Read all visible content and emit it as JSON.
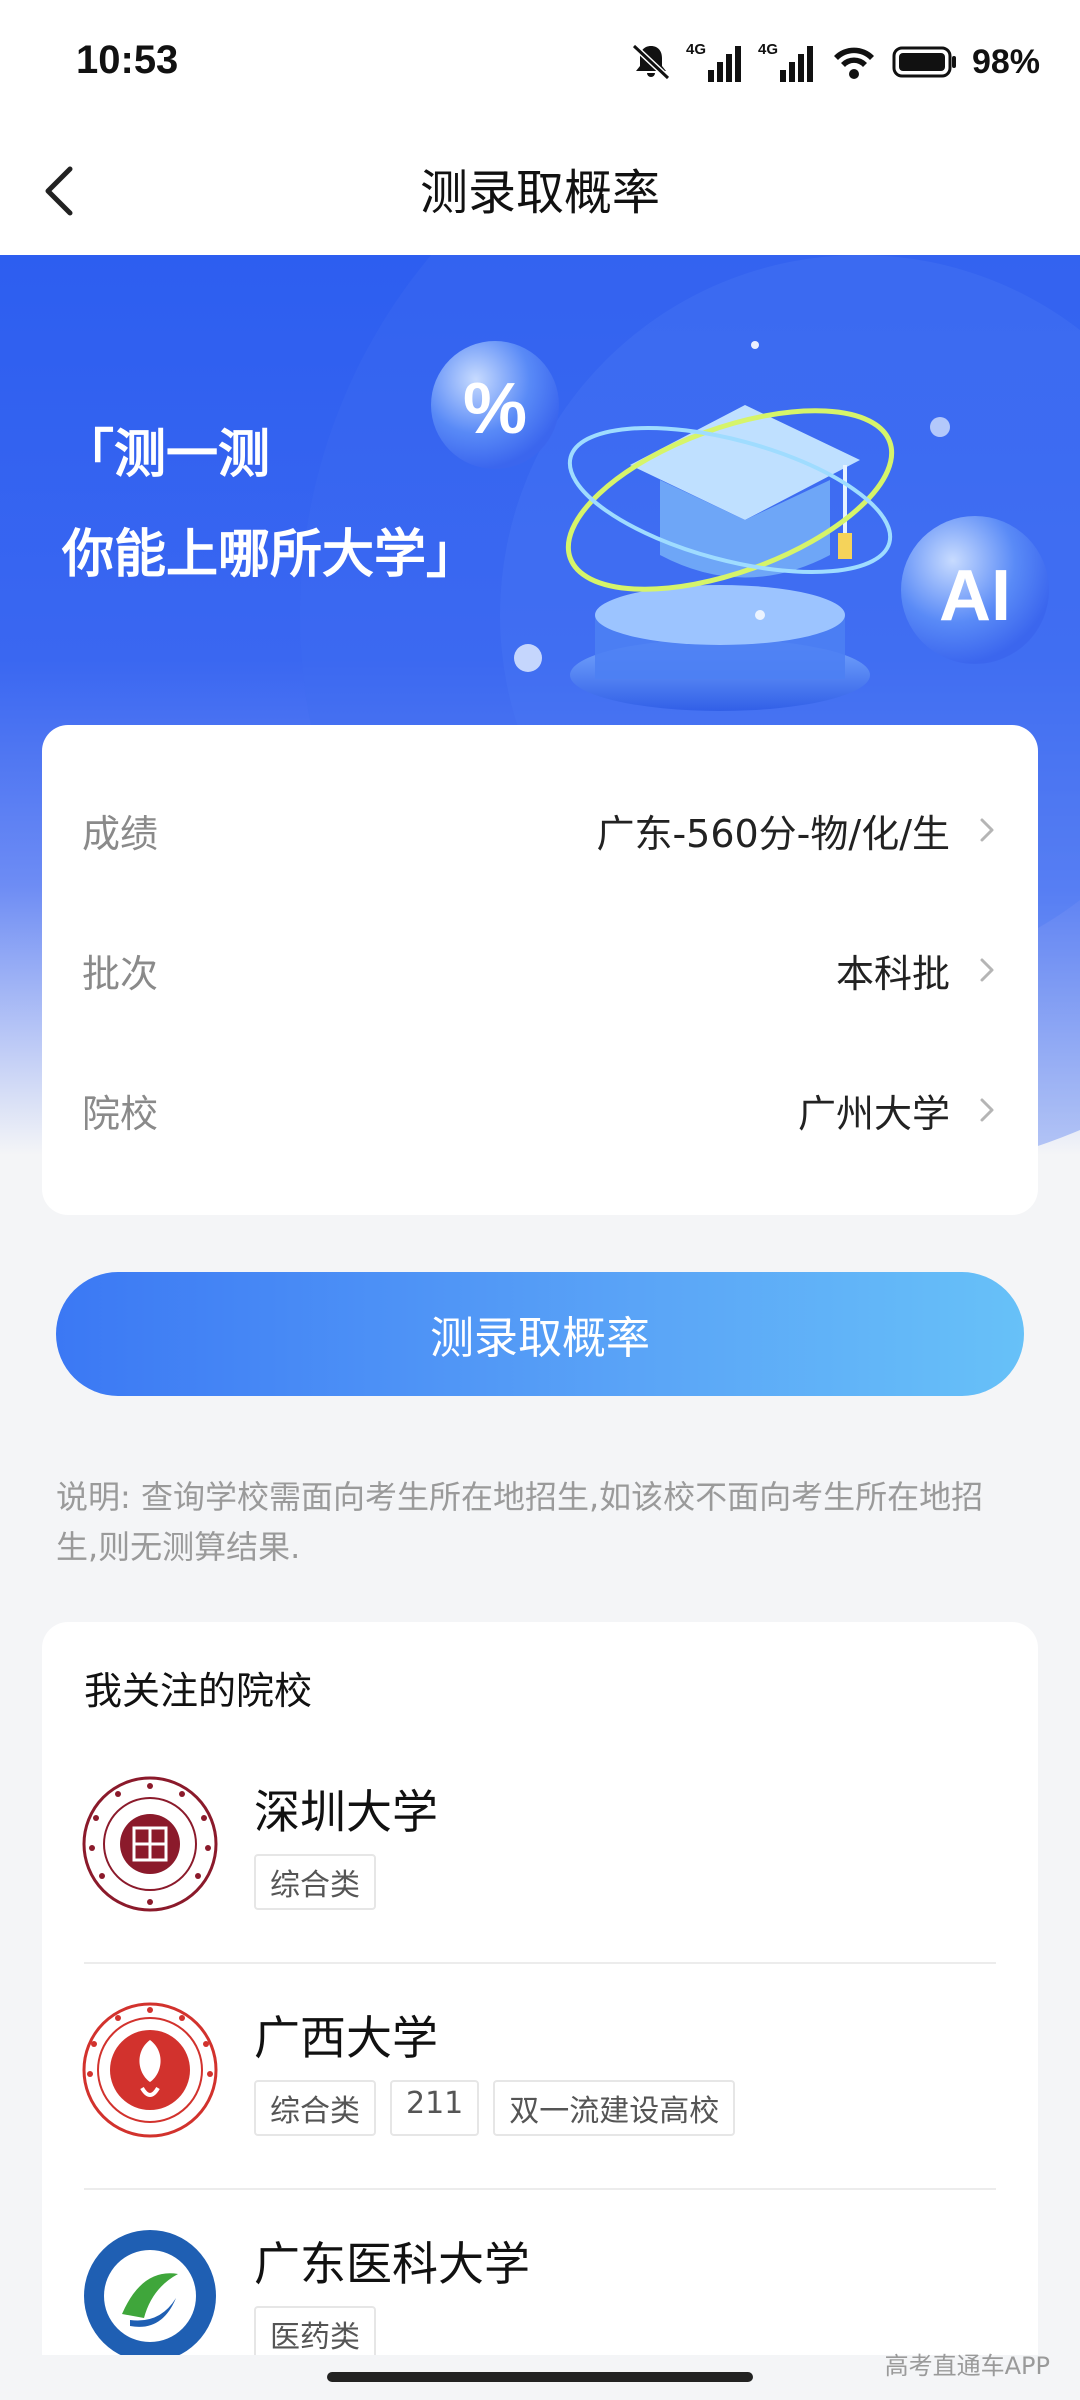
{
  "status_bar": {
    "time": "10:53",
    "battery": "98%",
    "icons": [
      "mute-icon",
      "signal-4g-icon",
      "signal-4g-icon",
      "wifi-icon",
      "battery-icon"
    ]
  },
  "nav": {
    "title": "测录取概率",
    "back_icon": "chevron-left-icon"
  },
  "banner": {
    "line1": "「测一测",
    "line2": "你能上哪所大学」",
    "badge_percent": "%",
    "badge_ai": "AI"
  },
  "form": {
    "rows": [
      {
        "label": "成绩",
        "value": "广东-560分-物/化/生"
      },
      {
        "label": "批次",
        "value": "本科批"
      },
      {
        "label": "院校",
        "value": "广州大学"
      }
    ]
  },
  "cta": {
    "label": "测录取概率"
  },
  "note": "说明: 查询学校需面向考生所在地招生,如该校不面向考生所在地招生,则无测算结果.",
  "schools": {
    "title": "我关注的院校",
    "items": [
      {
        "name": "深圳大学",
        "tags": [
          "综合类"
        ]
      },
      {
        "name": "广西大学",
        "tags": [
          "综合类",
          "211",
          "双一流建设高校"
        ]
      },
      {
        "name": "广东医科大学",
        "tags": [
          "医药类"
        ]
      }
    ]
  },
  "watermark": "高考直通车APP",
  "colors": {
    "accent": "#2d5ef0",
    "cta_start": "#3b78f4",
    "cta_end": "#67c1f8"
  }
}
